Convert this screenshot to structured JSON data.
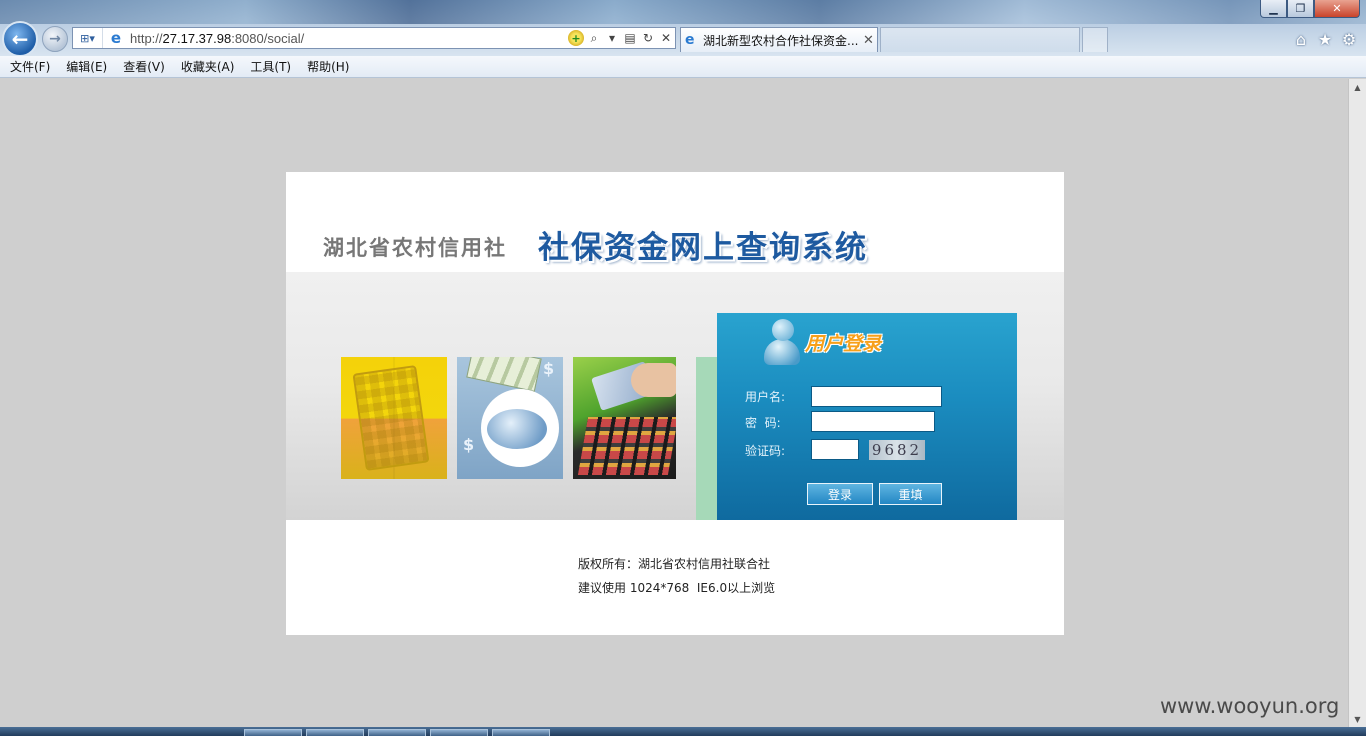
{
  "browser": {
    "url": "http://27.17.37.98:8080/social/",
    "url_prefix": "http://",
    "url_host": "27.17.37.98",
    "url_rest": ":8080/social/",
    "active_tab_title": "湖北新型农村合作社保资金...",
    "menu": [
      "文件(F)",
      "编辑(E)",
      "查看(V)",
      "收藏夹(A)",
      "工具(T)",
      "帮助(H)"
    ]
  },
  "page": {
    "org_name": "湖北省农村信用社",
    "system_name": "社保资金网上查询系统",
    "login": {
      "title": "用户登录",
      "username_label": "用户名:",
      "password_label": "密  码:",
      "captcha_label": "验证码:",
      "captcha_text": "9682",
      "username_value": "",
      "password_value": "",
      "captcha_value": "",
      "login_button": "登录",
      "reset_button": "重填"
    },
    "footer": {
      "copyright": "版权所有：湖北省农村信用社联合社",
      "recommend": "建议使用 1024*768  IE6.0以上浏览"
    }
  },
  "watermark": "www.wooyun.org",
  "colors": {
    "login_panel": "#1b8dc0",
    "system_title": "#1e5aa0",
    "login_title": "#f7a01a",
    "page_bg": "#cfcfcf"
  }
}
